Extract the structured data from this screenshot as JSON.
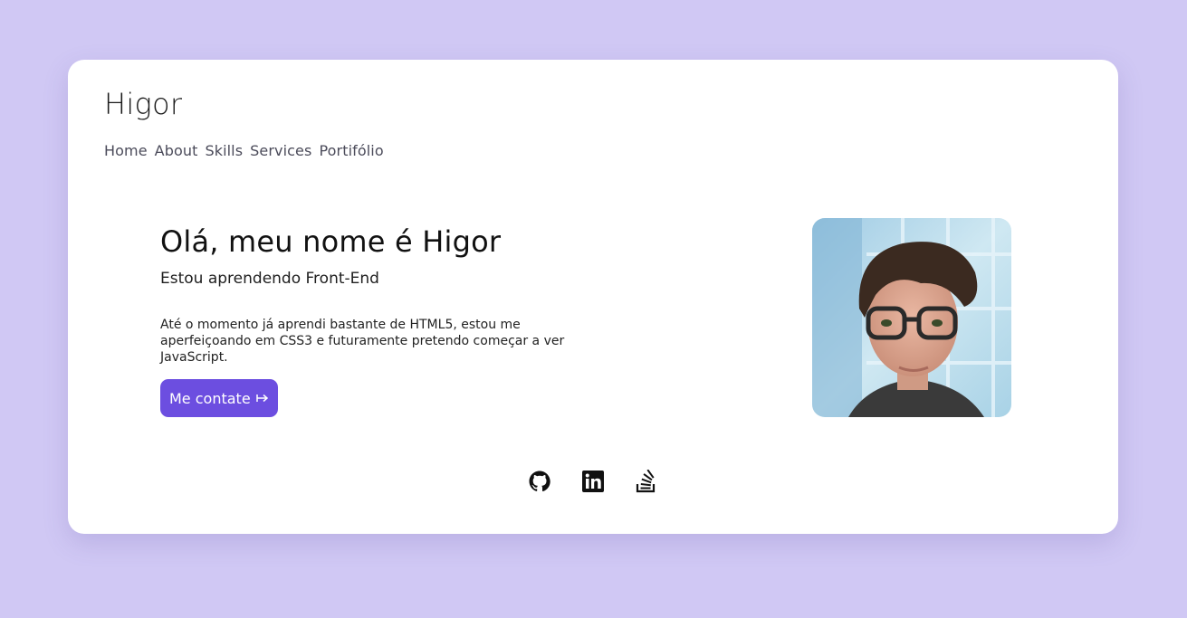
{
  "header": {
    "logo": "Higor",
    "nav": [
      {
        "label": "Home"
      },
      {
        "label": "About"
      },
      {
        "label": "Skills"
      },
      {
        "label": "Services"
      },
      {
        "label": "Portifólio"
      }
    ]
  },
  "hero": {
    "title": "Olá, meu nome é Higor",
    "subtitle": "Estou aprendendo Front-End",
    "description": "Até o momento já aprendi bastante de HTML5, estou me aperfeiçoando em CSS3 e futuramente pretendo começar a ver JavaScript.",
    "cta_label": "Me contate",
    "cta_icon": "arrow-right-bar-icon"
  },
  "socials": [
    {
      "icon": "github-icon"
    },
    {
      "icon": "linkedin-icon"
    },
    {
      "icon": "stackoverflow-icon"
    }
  ],
  "colors": {
    "page_background": "#d0c8f4",
    "card_background": "#ffffff",
    "accent": "#6c4ee0"
  }
}
